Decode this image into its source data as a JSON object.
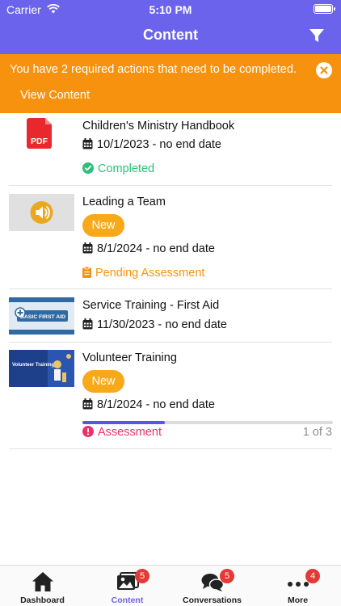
{
  "status_bar": {
    "carrier": "Carrier",
    "time": "5:10 PM"
  },
  "header": {
    "title": "Content",
    "filter_icon": "filter-icon"
  },
  "alert": {
    "message": "You have 2 required actions that need to be completed.",
    "link": "View Content",
    "close_icon": "close-circle-icon"
  },
  "items": [
    {
      "title": "Children's Ministry Handbook",
      "thumbnail": "pdf-icon",
      "thumbnail_label": "PDF",
      "date": "10/1/2023 - no end date",
      "status": "Completed",
      "status_color": "#2bbf7a"
    },
    {
      "title": "Leading a Team",
      "thumbnail": "audio-speaker-icon",
      "badge": "New",
      "date": "8/1/2024 - no end date",
      "status": "Pending Assessment",
      "status_color": "#f7920f"
    },
    {
      "title": "Service Training -  First Aid",
      "thumbnail": "first-aid-thumbnail",
      "thumbnail_label": "BASIC FIRST AID",
      "date": "11/30/2023 - no end date"
    },
    {
      "title": "Volunteer Training",
      "thumbnail": "volunteer-training-thumbnail",
      "thumbnail_label": "Volunteer Training",
      "badge": "New",
      "date": "8/1/2024 - no end date",
      "status": "Assessment",
      "status_color": "#e8336b",
      "progress": 0.33,
      "progress_text": "1 of 3"
    }
  ],
  "tabbar": {
    "tabs": [
      {
        "label": "Dashboard",
        "icon": "home-icon"
      },
      {
        "label": "Content",
        "icon": "photos-icon",
        "badge": "5",
        "active": true
      },
      {
        "label": "Conversations",
        "icon": "chat-bubbles-icon",
        "badge": "5"
      },
      {
        "label": "More",
        "icon": "more-dots-icon",
        "badge": "4"
      }
    ]
  },
  "colors": {
    "header": "#6c63ec",
    "alert": "#f7920f",
    "badge_new": "#f7a91a",
    "progress": "#5b57d9",
    "tab_badge": "#e53935"
  }
}
